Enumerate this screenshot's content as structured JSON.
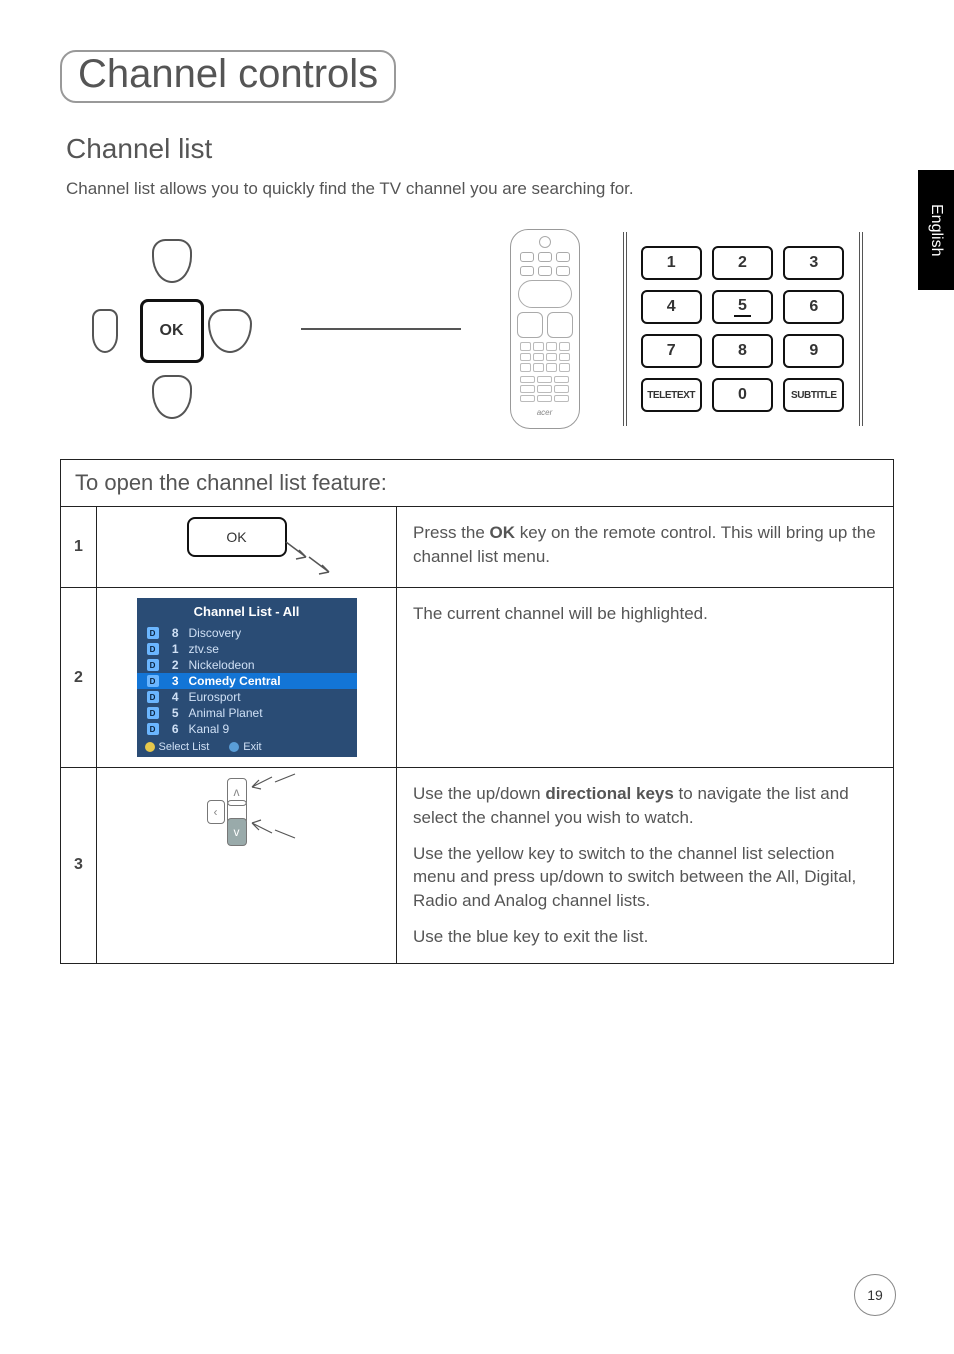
{
  "language_tab": "English",
  "page_number": "19",
  "page_title": "Channel controls",
  "section_title": "Channel list",
  "intro_text": "Channel list allows you to quickly find the TV channel you are searching for.",
  "dpad_ok_label": "OK",
  "remote_brand": "acer",
  "numpad": {
    "keys": [
      "1",
      "2",
      "3",
      "4",
      "5",
      "6",
      "7",
      "8",
      "9"
    ],
    "teletext": "TELETEXT",
    "zero": "0",
    "subtitle": "SUBTITLE"
  },
  "steps_table": {
    "header": "To open the channel list feature:",
    "rows": [
      {
        "num": "1",
        "figure_ok_label": "OK",
        "desc_before_bold": "Press the ",
        "desc_bold": "OK",
        "desc_after_bold": " key on the remote control. This will bring up the channel list menu."
      },
      {
        "num": "2",
        "channel_menu": {
          "title": "Channel List - All",
          "items": [
            {
              "d": "D",
              "num": "8",
              "name": "Discovery",
              "selected": false
            },
            {
              "d": "D",
              "num": "1",
              "name": "ztv.se",
              "selected": false
            },
            {
              "d": "D",
              "num": "2",
              "name": "Nickelodeon",
              "selected": false
            },
            {
              "d": "D",
              "num": "3",
              "name": "Comedy Central",
              "selected": true
            },
            {
              "d": "D",
              "num": "4",
              "name": "Eurosport",
              "selected": false
            },
            {
              "d": "D",
              "num": "5",
              "name": "Animal Planet",
              "selected": false
            },
            {
              "d": "D",
              "num": "6",
              "name": "Kanal 9",
              "selected": false
            }
          ],
          "footer_select": "Select List",
          "footer_exit": "Exit"
        },
        "desc": "The current channel will be highlighted."
      },
      {
        "num": "3",
        "p1_before_bold": "Use the up/down ",
        "p1_bold": "directional keys",
        "p1_after_bold": " to navigate the list and select the channel you wish to watch.",
        "p2": "Use the yellow key to switch to the channel list selection menu and press up/down to switch between the All, Digital, Radio and Analog channel lists.",
        "p3": "Use the blue key to exit the list."
      }
    ]
  }
}
